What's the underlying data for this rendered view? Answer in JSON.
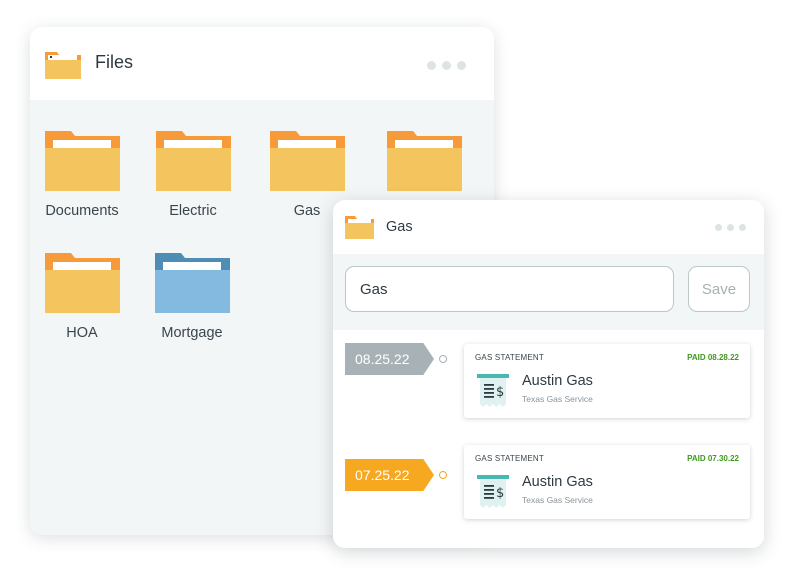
{
  "files_window": {
    "title": "Files",
    "folders": [
      {
        "label": "Documents",
        "color": "orange"
      },
      {
        "label": "Electric",
        "color": "orange"
      },
      {
        "label": "Gas",
        "color": "orange"
      },
      {
        "label": "",
        "color": "orange"
      },
      {
        "label": "HOA",
        "color": "orange"
      },
      {
        "label": "Mortgage",
        "color": "blue"
      }
    ]
  },
  "gas_window": {
    "title": "Gas",
    "search": {
      "value": "Gas"
    },
    "save_label": "Save",
    "entries": [
      {
        "date": "08.25.22",
        "tag_color": "gray",
        "kind": "GAS STATEMENT",
        "paid": "PAID 08.28.22",
        "company": "Austin Gas",
        "provider": "Texas Gas Service"
      },
      {
        "date": "07.25.22",
        "tag_color": "orange",
        "kind": "GAS STATEMENT",
        "paid": "PAID 07.30.22",
        "company": "Austin Gas",
        "provider": "Texas Gas Service"
      }
    ]
  },
  "colors": {
    "folder_back": "#f79a3a",
    "folder_front": "#f4c55e",
    "folder_blue_back": "#4f8db5",
    "folder_blue_front": "#84b9e0",
    "tag_gray": "#a8b2b6",
    "tag_orange": "#f6a821",
    "paid_green": "#3e9a1f",
    "receipt_teal": "#49b8b3"
  }
}
